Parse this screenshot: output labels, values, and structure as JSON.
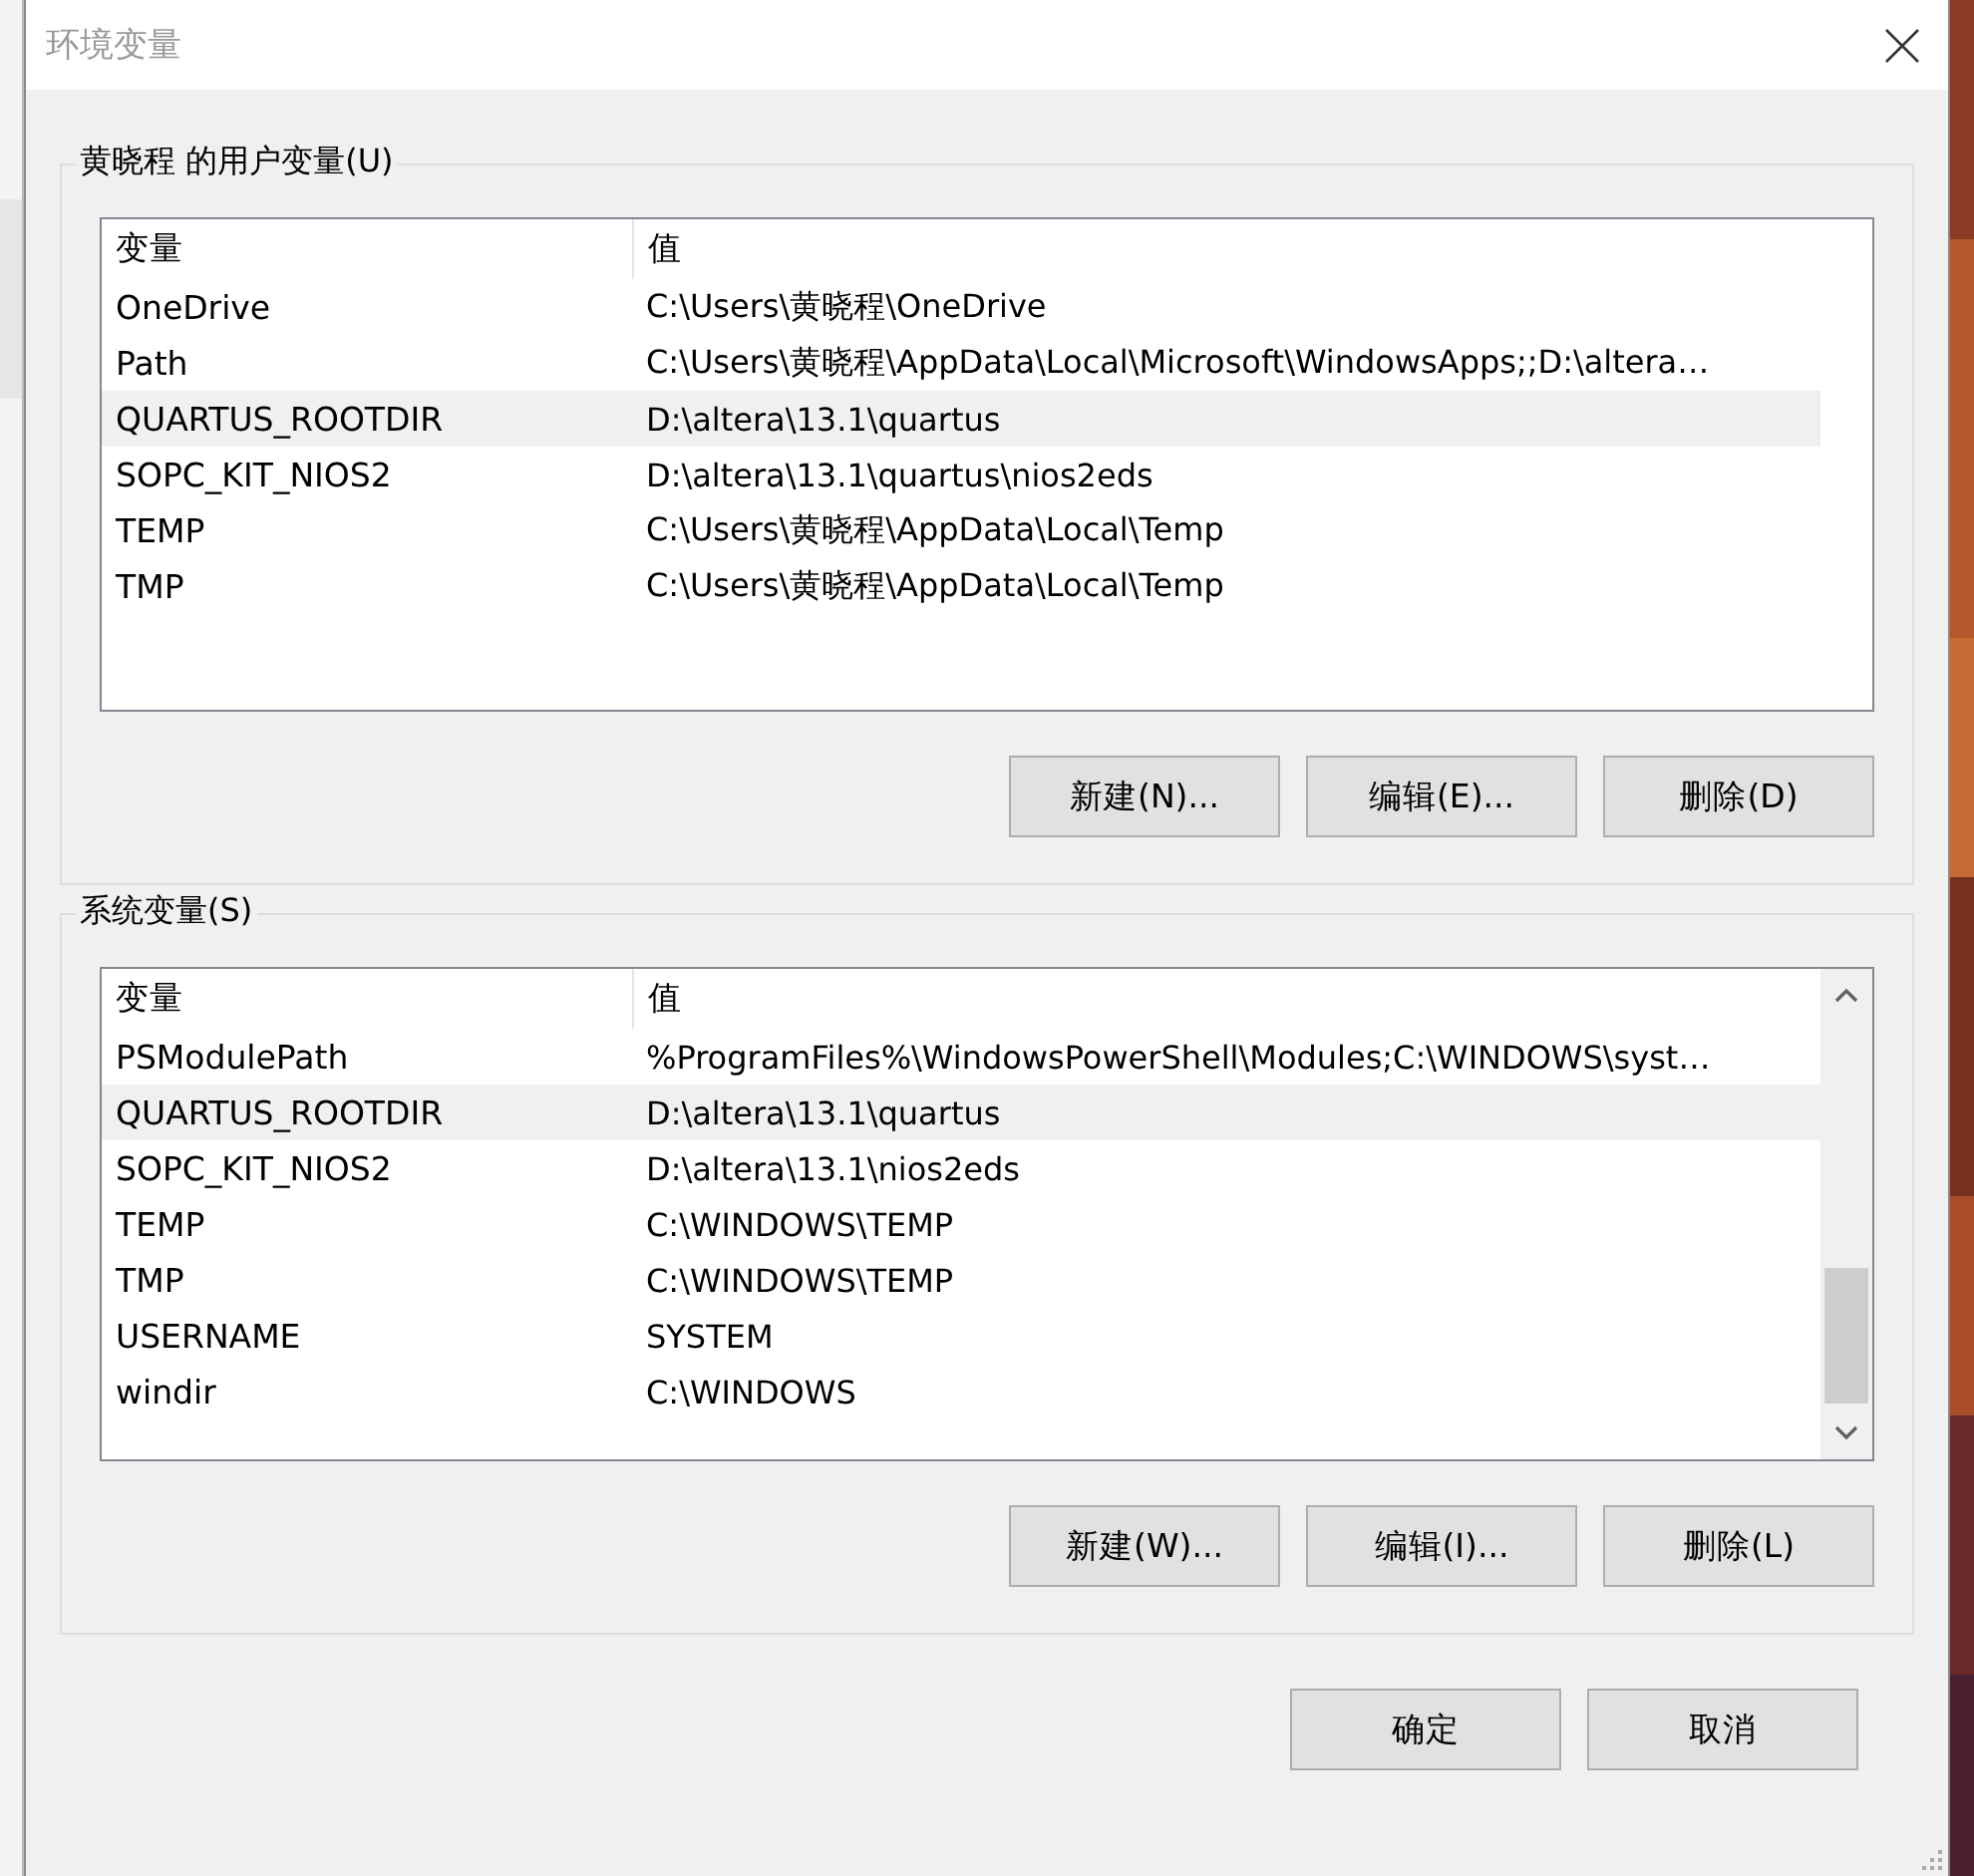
{
  "window": {
    "title": "环境变量"
  },
  "user_variables": {
    "title": "黄晓程 的用户变量(U)",
    "columns": [
      "变量",
      "值"
    ],
    "rows": [
      {
        "name": "OneDrive",
        "value": "C:\\Users\\黄晓程\\OneDrive",
        "selected": false
      },
      {
        "name": "Path",
        "value": "C:\\Users\\黄晓程\\AppData\\Local\\Microsoft\\WindowsApps;;D:\\altera…",
        "selected": false
      },
      {
        "name": "QUARTUS_ROOTDIR",
        "value": "D:\\altera\\13.1\\quartus",
        "selected": true
      },
      {
        "name": "SOPC_KIT_NIOS2",
        "value": "D:\\altera\\13.1\\quartus\\nios2eds",
        "selected": false
      },
      {
        "name": "TEMP",
        "value": "C:\\Users\\黄晓程\\AppData\\Local\\Temp",
        "selected": false
      },
      {
        "name": "TMP",
        "value": "C:\\Users\\黄晓程\\AppData\\Local\\Temp",
        "selected": false
      }
    ],
    "buttons": [
      "新建(N)...",
      "编辑(E)...",
      "删除(D)"
    ]
  },
  "system_variables": {
    "title": "系统变量(S)",
    "columns": [
      "变量",
      "值"
    ],
    "rows": [
      {
        "name": "PSModulePath",
        "value": "%ProgramFiles%\\WindowsPowerShell\\Modules;C:\\WINDOWS\\syst…",
        "selected": false
      },
      {
        "name": "QUARTUS_ROOTDIR",
        "value": "D:\\altera\\13.1\\quartus",
        "selected": true
      },
      {
        "name": "SOPC_KIT_NIOS2",
        "value": "D:\\altera\\13.1\\nios2eds",
        "selected": false
      },
      {
        "name": "TEMP",
        "value": "C:\\WINDOWS\\TEMP",
        "selected": false
      },
      {
        "name": "TMP",
        "value": "C:\\WINDOWS\\TEMP",
        "selected": false
      },
      {
        "name": "USERNAME",
        "value": "SYSTEM",
        "selected": false
      },
      {
        "name": "windir",
        "value": "C:\\WINDOWS",
        "selected": false
      }
    ],
    "buttons": [
      "新建(W)...",
      "编辑(I)...",
      "删除(L)"
    ]
  },
  "dialog_buttons": [
    "确定",
    "取消"
  ]
}
